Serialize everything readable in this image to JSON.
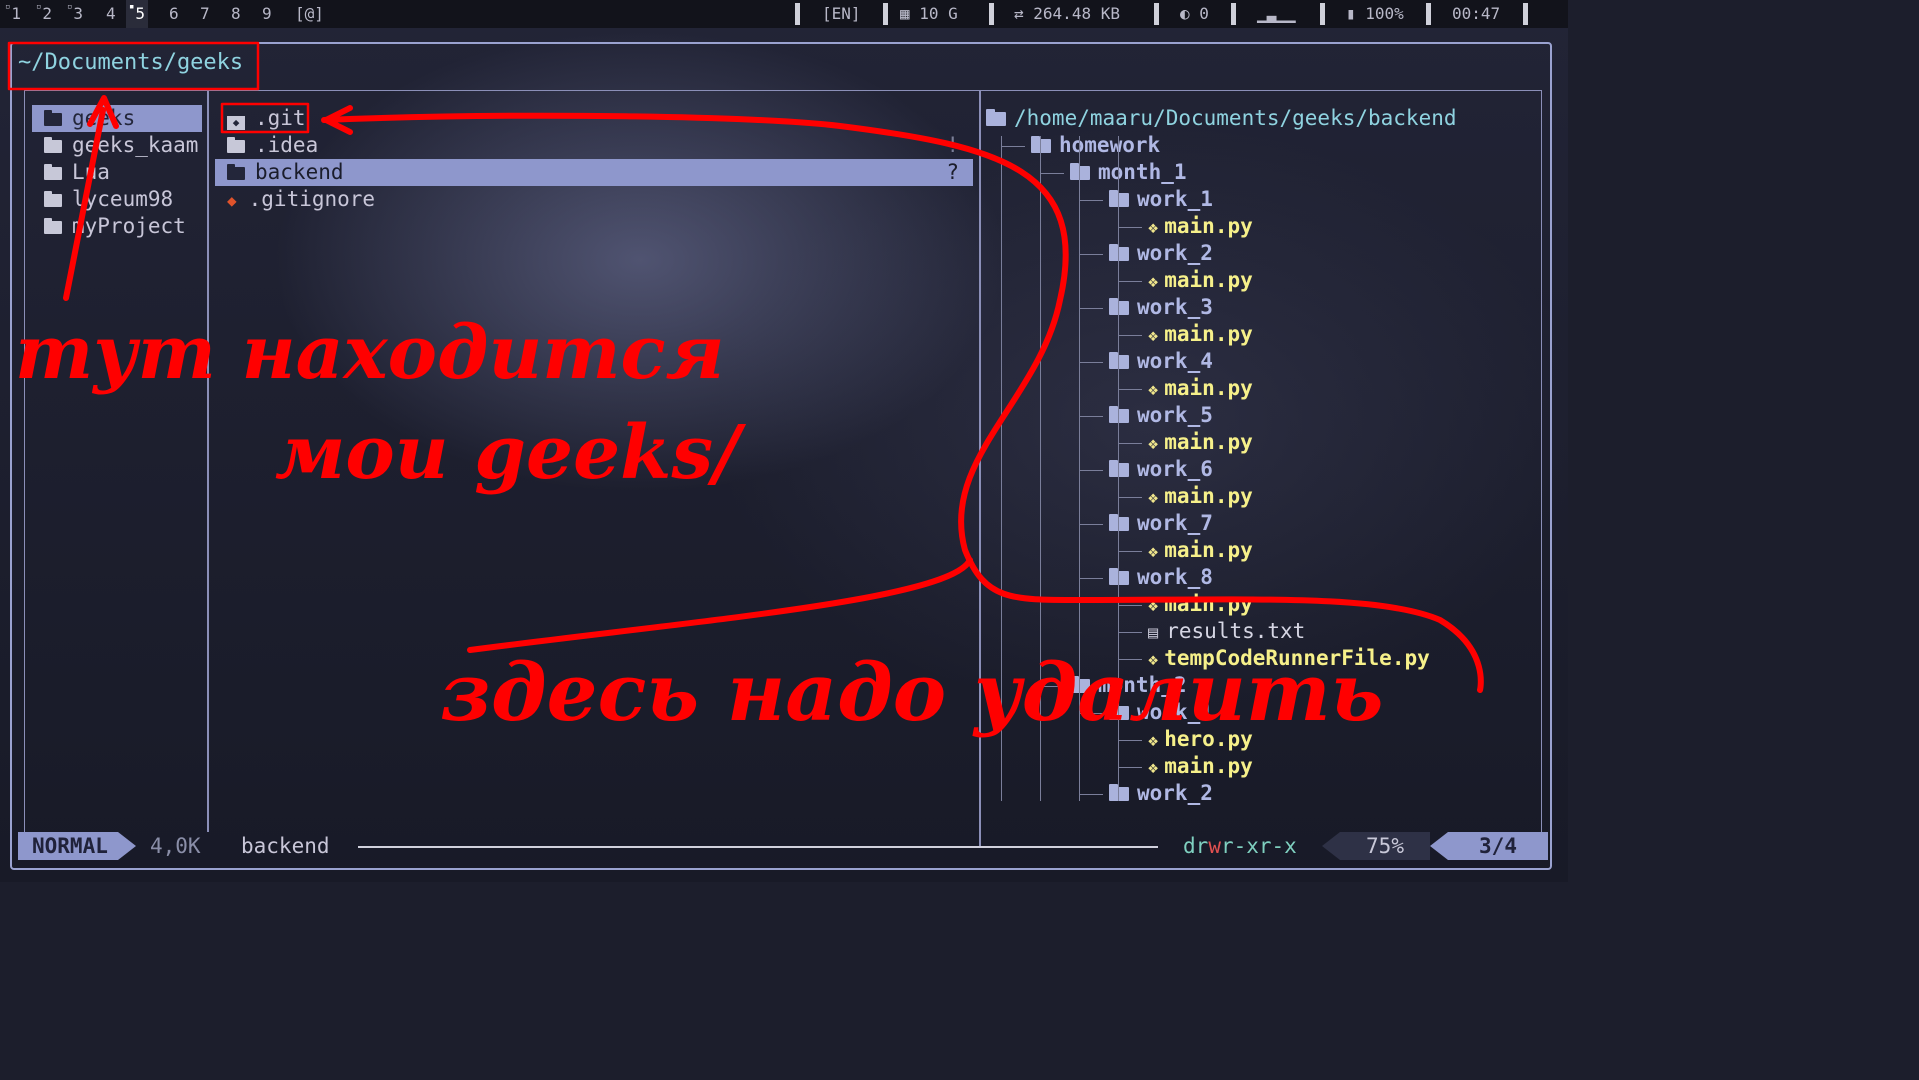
{
  "topbar": {
    "workspaces": [
      {
        "label": "1",
        "marked": true
      },
      {
        "label": "2",
        "marked": true
      },
      {
        "label": "3",
        "marked": true
      },
      {
        "label": "4",
        "marked": false
      },
      {
        "label": "5",
        "marked": true,
        "active": true
      },
      {
        "label": "6",
        "marked": false
      },
      {
        "label": "7",
        "marked": false
      },
      {
        "label": "8",
        "marked": false
      },
      {
        "label": "9",
        "marked": false
      },
      {
        "label": "[@]",
        "marked": false
      }
    ],
    "keyboard_layout": "[EN]",
    "memory": "10 G",
    "network": "264.48 KB",
    "network_icon": "swap-arrows-icon",
    "notifications": "0",
    "volume_level_glyph": "▁▃▁▁",
    "battery": "100%",
    "clock": "00:47"
  },
  "header": {
    "path": "~/Documents/geeks"
  },
  "parent_column": {
    "items": [
      "geeks",
      "geeks_kaam",
      "Lua",
      "lyceum98",
      "myProject"
    ],
    "selected_index": 0
  },
  "current_column": {
    "items": [
      {
        "name": ".git",
        "icon": "git-folder-icon",
        "badge": ""
      },
      {
        "name": ".idea",
        "icon": "folder-icon",
        "badge": "!"
      },
      {
        "name": "backend",
        "icon": "folder-icon",
        "badge": "?"
      },
      {
        "name": ".gitignore",
        "icon": "git-file-icon",
        "badge": ""
      }
    ],
    "selected_index": 2
  },
  "preview": {
    "root_path": "/home/maaru/Documents/geeks/backend",
    "tree": [
      {
        "name": "homework",
        "type": "dir",
        "depth": 1
      },
      {
        "name": "month_1",
        "type": "dir",
        "depth": 2
      },
      {
        "name": "work_1",
        "type": "dir",
        "depth": 3
      },
      {
        "name": "main.py",
        "type": "py",
        "depth": 4
      },
      {
        "name": "work_2",
        "type": "dir",
        "depth": 3
      },
      {
        "name": "main.py",
        "type": "py",
        "depth": 4
      },
      {
        "name": "work_3",
        "type": "dir",
        "depth": 3
      },
      {
        "name": "main.py",
        "type": "py",
        "depth": 4
      },
      {
        "name": "work_4",
        "type": "dir",
        "depth": 3
      },
      {
        "name": "main.py",
        "type": "py",
        "depth": 4
      },
      {
        "name": "work_5",
        "type": "dir",
        "depth": 3
      },
      {
        "name": "main.py",
        "type": "py",
        "depth": 4
      },
      {
        "name": "work_6",
        "type": "dir",
        "depth": 3
      },
      {
        "name": "main.py",
        "type": "py",
        "depth": 4
      },
      {
        "name": "work_7",
        "type": "dir",
        "depth": 3
      },
      {
        "name": "main.py",
        "type": "py",
        "depth": 4
      },
      {
        "name": "work_8",
        "type": "dir",
        "depth": 3
      },
      {
        "name": "main.py",
        "type": "py",
        "depth": 4
      },
      {
        "name": "results.txt",
        "type": "txt",
        "depth": 4
      },
      {
        "name": "tempCodeRunnerFile.py",
        "type": "py",
        "depth": 4
      },
      {
        "name": "month_2",
        "type": "dir",
        "depth": 2
      },
      {
        "name": "work_1",
        "type": "dir",
        "depth": 3
      },
      {
        "name": "hero.py",
        "type": "py",
        "depth": 4
      },
      {
        "name": "main.py",
        "type": "py",
        "depth": 4
      },
      {
        "name": "work_2",
        "type": "dir",
        "depth": 3
      }
    ]
  },
  "statusbar": {
    "mode": "NORMAL",
    "size": "4,0K",
    "selected_name": "backend",
    "permissions": {
      "d": "d",
      "r1": "r",
      "w1": "w",
      "x1": "x",
      "rest": "r-xr-x"
    },
    "percent": "75%",
    "position": "3/4"
  },
  "annotations": {
    "text_1_line_1": "тут находится",
    "text_1_line_2": "мои geeks/",
    "text_2": "здесь надо удалить",
    "color": "#ff0000"
  }
}
